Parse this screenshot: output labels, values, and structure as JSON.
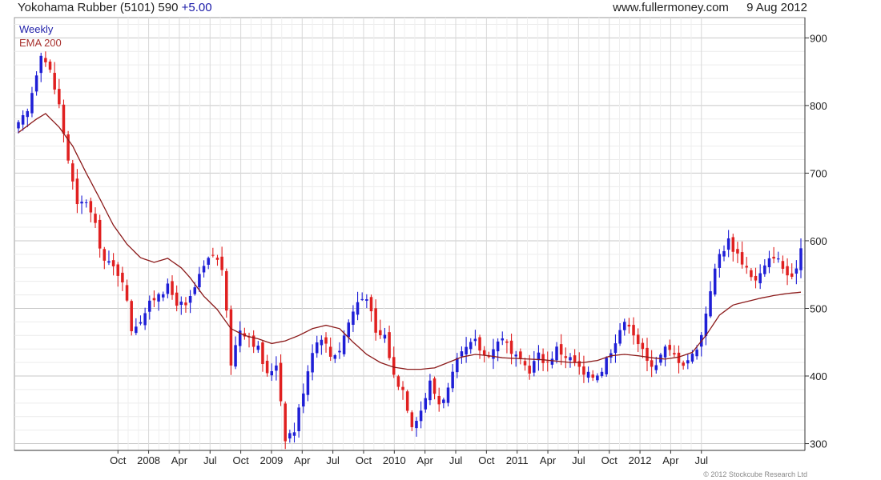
{
  "header": {
    "stock_name": "Yokohama Rubber (5101)",
    "price": "590",
    "change": "+5.00",
    "site": "www.fullermoney.com",
    "date": "9 Aug 2012"
  },
  "legend": {
    "frequency": "Weekly",
    "indicator": "EMA 200"
  },
  "copyright": "© 2012 Stockcube Research Ltd",
  "colors": {
    "up_candle": "#1f1fd6",
    "down_candle": "#e02020",
    "ema_line": "#8b1a1a",
    "grid": "#d8d8d8",
    "axis": "#333333"
  },
  "chart_data": {
    "type": "candlestick",
    "frequency": "Weekly",
    "ylim": [
      290,
      930
    ],
    "grid": true,
    "y_axis_position": "right",
    "y_ticks": [
      300,
      400,
      500,
      600,
      700,
      800,
      900
    ],
    "x_tick_labels": [
      "Oct",
      "2008",
      "Apr",
      "Jul",
      "Oct",
      "2009",
      "Apr",
      "Jul",
      "Oct",
      "2010",
      "Apr",
      "Jul",
      "Oct",
      "2011",
      "Apr",
      "Jul",
      "Oct",
      "2012",
      "Apr",
      "Jul"
    ],
    "close_anchors": [
      [
        0,
        770
      ],
      [
        2,
        790
      ],
      [
        5,
        880
      ],
      [
        7,
        850
      ],
      [
        9,
        800
      ],
      [
        11,
        720
      ],
      [
        13,
        650
      ],
      [
        15,
        660
      ],
      [
        17,
        620
      ],
      [
        19,
        570
      ],
      [
        21,
        560
      ],
      [
        23,
        545
      ],
      [
        25,
        470
      ],
      [
        27,
        485
      ],
      [
        29,
        505
      ],
      [
        31,
        525
      ],
      [
        33,
        530
      ],
      [
        35,
        510
      ],
      [
        37,
        500
      ],
      [
        39,
        530
      ],
      [
        41,
        560
      ],
      [
        43,
        580
      ],
      [
        45,
        560
      ],
      [
        47,
        420
      ],
      [
        49,
        470
      ],
      [
        51,
        460
      ],
      [
        53,
        440
      ],
      [
        55,
        400
      ],
      [
        57,
        420
      ],
      [
        59,
        310
      ],
      [
        61,
        320
      ],
      [
        63,
        380
      ],
      [
        65,
        440
      ],
      [
        67,
        460
      ],
      [
        69,
        430
      ],
      [
        71,
        440
      ],
      [
        73,
        480
      ],
      [
        75,
        510
      ],
      [
        77,
        520
      ],
      [
        79,
        460
      ],
      [
        81,
        460
      ],
      [
        83,
        400
      ],
      [
        85,
        380
      ],
      [
        87,
        330
      ],
      [
        89,
        350
      ],
      [
        91,
        390
      ],
      [
        93,
        360
      ],
      [
        95,
        380
      ],
      [
        97,
        420
      ],
      [
        99,
        440
      ],
      [
        101,
        450
      ],
      [
        103,
        430
      ],
      [
        105,
        440
      ],
      [
        107,
        460
      ],
      [
        109,
        430
      ],
      [
        111,
        420
      ],
      [
        113,
        410
      ],
      [
        115,
        430
      ],
      [
        117,
        420
      ],
      [
        119,
        440
      ],
      [
        121,
        430
      ],
      [
        123,
        420
      ],
      [
        125,
        400
      ],
      [
        127,
        400
      ],
      [
        129,
        410
      ],
      [
        131,
        440
      ],
      [
        133,
        470
      ],
      [
        135,
        480
      ],
      [
        137,
        450
      ],
      [
        139,
        420
      ],
      [
        141,
        420
      ],
      [
        143,
        440
      ],
      [
        145,
        430
      ],
      [
        147,
        420
      ],
      [
        149,
        430
      ],
      [
        151,
        460
      ],
      [
        153,
        530
      ],
      [
        155,
        580
      ],
      [
        157,
        600
      ],
      [
        159,
        580
      ],
      [
        161,
        560
      ],
      [
        163,
        540
      ],
      [
        165,
        560
      ],
      [
        167,
        580
      ],
      [
        169,
        560
      ],
      [
        171,
        540
      ],
      [
        173,
        590
      ]
    ],
    "ema200_anchors": [
      [
        0,
        760
      ],
      [
        2,
        770
      ],
      [
        4,
        780
      ],
      [
        6,
        788
      ],
      [
        9,
        768
      ],
      [
        12,
        740
      ],
      [
        15,
        700
      ],
      [
        18,
        662
      ],
      [
        21,
        623
      ],
      [
        24,
        595
      ],
      [
        27,
        575
      ],
      [
        30,
        568
      ],
      [
        33,
        574
      ],
      [
        36,
        560
      ],
      [
        38,
        545
      ],
      [
        41,
        518
      ],
      [
        44,
        498
      ],
      [
        47,
        470
      ],
      [
        50,
        460
      ],
      [
        53,
        455
      ],
      [
        56,
        448
      ],
      [
        59,
        452
      ],
      [
        62,
        460
      ],
      [
        65,
        470
      ],
      [
        68,
        475
      ],
      [
        71,
        470
      ],
      [
        74,
        450
      ],
      [
        77,
        432
      ],
      [
        80,
        420
      ],
      [
        83,
        413
      ],
      [
        86,
        410
      ],
      [
        89,
        410
      ],
      [
        92,
        412
      ],
      [
        95,
        420
      ],
      [
        98,
        428
      ],
      [
        101,
        432
      ],
      [
        104,
        430
      ],
      [
        107,
        427
      ],
      [
        110,
        426
      ],
      [
        113,
        425
      ],
      [
        116,
        424
      ],
      [
        119,
        422
      ],
      [
        122,
        420
      ],
      [
        125,
        420
      ],
      [
        128,
        423
      ],
      [
        131,
        430
      ],
      [
        134,
        432
      ],
      [
        137,
        430
      ],
      [
        140,
        427
      ],
      [
        143,
        425
      ],
      [
        146,
        428
      ],
      [
        149,
        435
      ],
      [
        152,
        460
      ],
      [
        155,
        490
      ],
      [
        158,
        505
      ],
      [
        161,
        510
      ],
      [
        164,
        515
      ],
      [
        167,
        519
      ],
      [
        170,
        522
      ],
      [
        173,
        524
      ]
    ],
    "last_close": 590,
    "last_change": 5.0
  }
}
